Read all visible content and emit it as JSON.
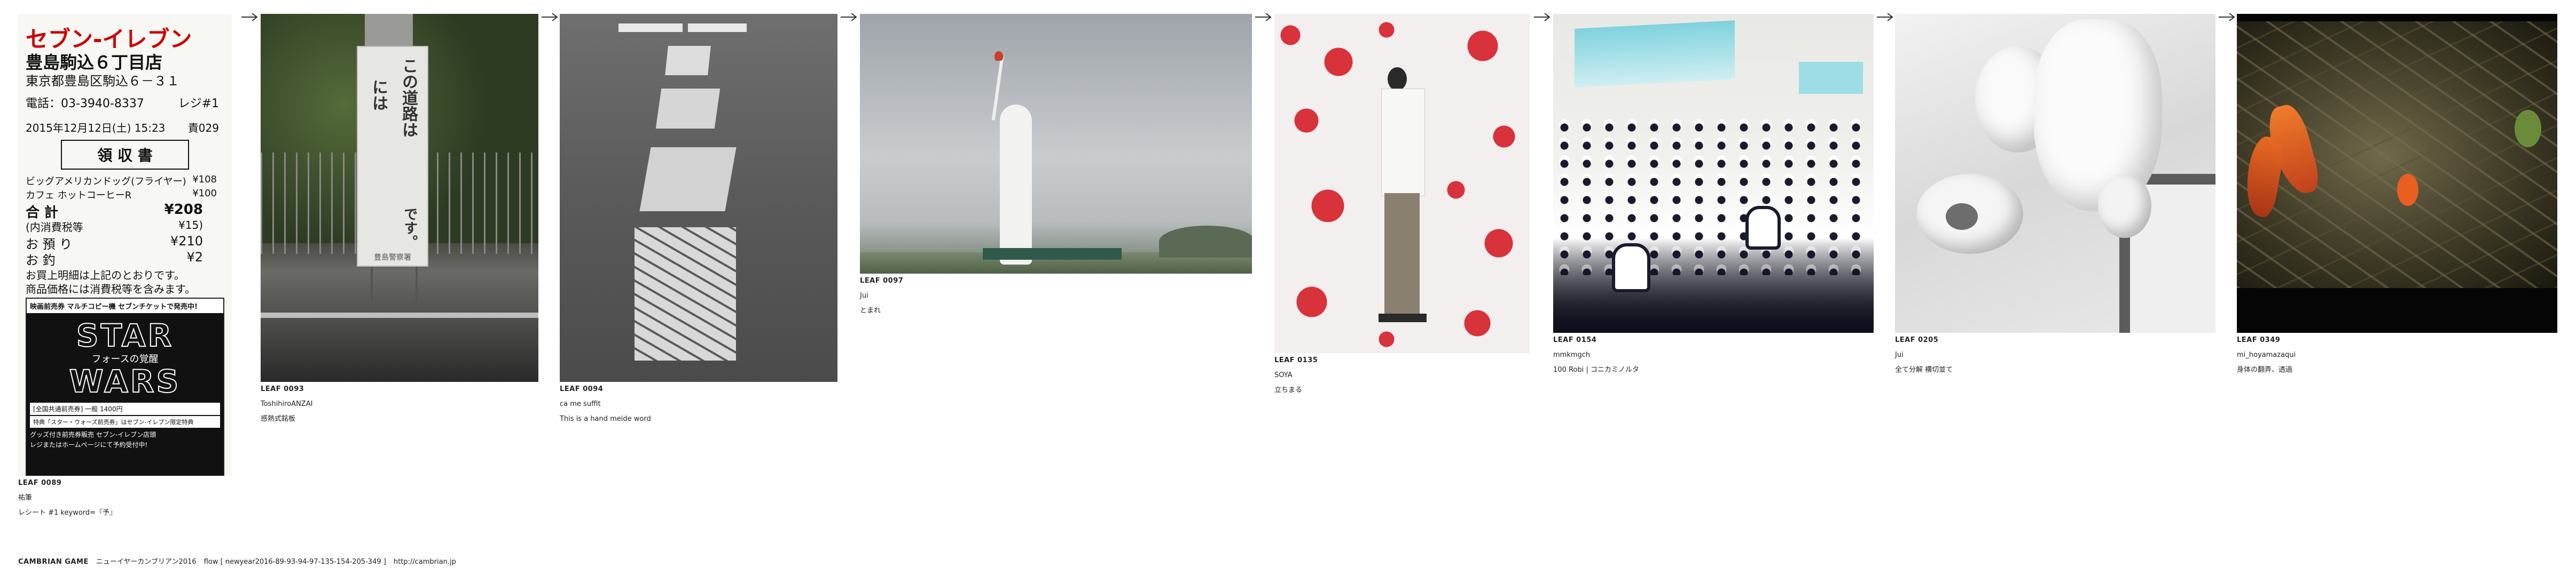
{
  "cards": [
    {
      "id": "LEAF 0089",
      "author": "祐筆",
      "caption": "レシート #1 keyword=『予』",
      "image_text": {
        "store_name": "セブン-イレブン",
        "branch": "豊島駒込６丁目店",
        "address": "東京都豊島区駒込６－３１",
        "phone": "電話：03-3940-8337",
        "register": "レジ#1",
        "datetime": "2015年12月12日(土) 15:23",
        "staff": "責029",
        "receipt_title": "領 収 書",
        "item1": "ビッグアメリカンドッグ(フライヤー)",
        "item1_price": "¥108",
        "item2": "カフェ ホットコーヒーR",
        "item2_price": "¥100",
        "total_label": "合 計",
        "total_value": "¥208",
        "tax_label": "(内消費税等",
        "tax_value": "¥15)",
        "paid_label": "お 預 り",
        "paid_value": "¥210",
        "change_label": "お 釣",
        "change_value": "¥2",
        "note1": "お買上明細は上記のとおりです。",
        "note2": "商品価格には消費税等を含みます。",
        "poster_head": "映画前売券 マルチコピー機 セブンチケットで発売中!",
        "poster_title1": "STAR",
        "poster_title2": "WARS",
        "poster_sub": "フォースの覚醒",
        "poster_price": "[全国共通前売券] 一般 1400円",
        "poster_note1": "特典「スター・ウォーズ前売券」はセブン-イレブン限定特典",
        "poster_note2": "グッズ付き前売券販売 セブン-イレブン店頭",
        "poster_note3": "レジまたはホームページにて予約受付中!"
      }
    },
    {
      "id": "LEAF 0093",
      "author": "ToshihiroANZAI",
      "caption": "感熱式銘板",
      "image_text": {
        "sign_line1": "この道路は",
        "sign_line2": "には",
        "sign_line3": "です。",
        "sign_footer": "豊島警察署"
      }
    },
    {
      "id": "LEAF 0094",
      "author": "ca me suffit",
      "caption": "This is a hand meide word",
      "image_text": {}
    },
    {
      "id": "LEAF 0097",
      "author": "Jui",
      "caption": "とまれ",
      "image_text": {}
    },
    {
      "id": "LEAF 0135",
      "author": "SOYA",
      "caption": "立ちまる",
      "image_text": {}
    },
    {
      "id": "LEAF 0154",
      "author": "mmkmgch",
      "caption": "100 Robi | コニカミノルタ",
      "image_text": {}
    },
    {
      "id": "LEAF 0205",
      "author": "Jui",
      "caption": "全て分解 横切並て",
      "image_text": {}
    },
    {
      "id": "LEAF 0349",
      "author": "mi_hoyamazaqui",
      "caption": "身体の翻弄、透過",
      "image_text": {}
    }
  ],
  "footer": {
    "brand": "CAMBRIAN GAME",
    "game_title": "ニューイヤーカンブリアン2016",
    "flow": "flow [ newyear2016-89-93-94-97-135-154-205-349 ]",
    "url": "http://cambrian.jp"
  },
  "colors": {
    "background": "#ffffff",
    "text": "#222222",
    "arrow": "#333333"
  }
}
